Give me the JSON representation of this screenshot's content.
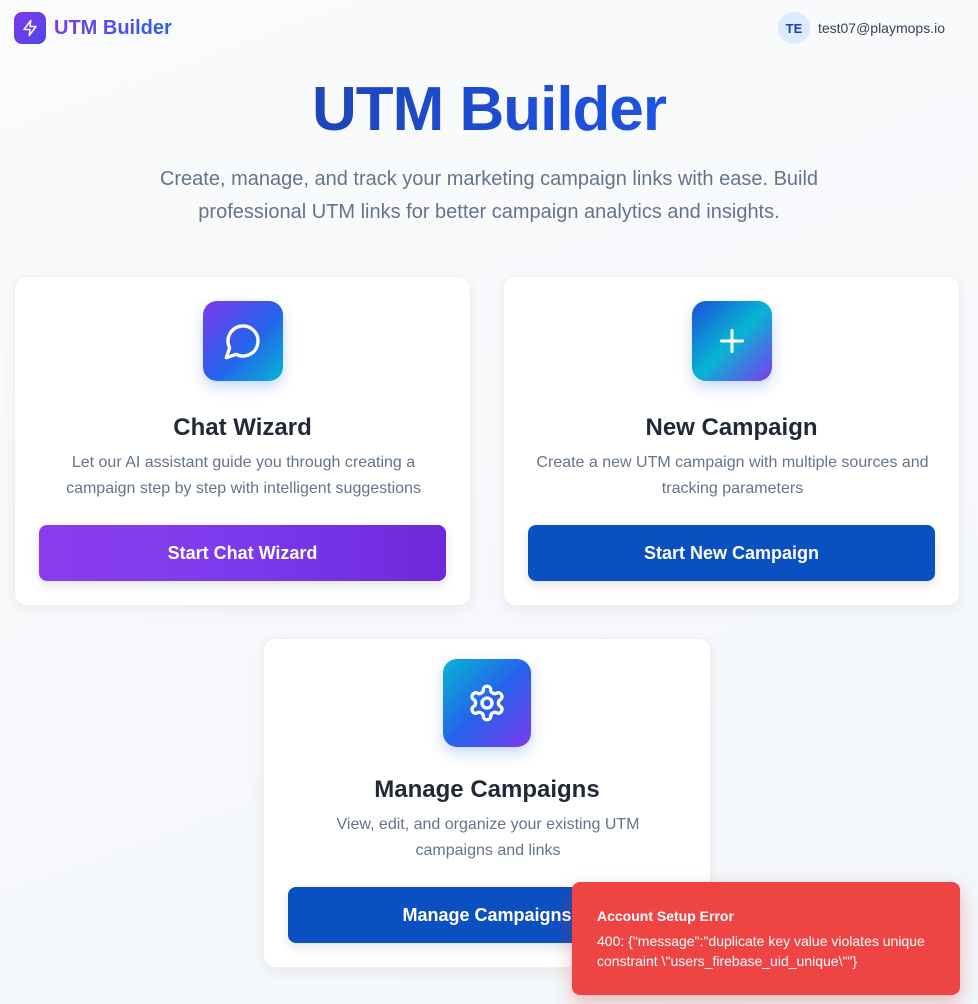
{
  "header": {
    "app_name": "UTM Builder",
    "logo_icon": "lightning-bolt-icon",
    "user": {
      "initials": "TE",
      "email": "test07@playmops.io"
    }
  },
  "hero": {
    "title": "UTM Builder",
    "subtitle": "Create, manage, and track your marketing campaign links with ease. Build professional UTM links for better campaign analytics and insights."
  },
  "cards": {
    "chat_wizard": {
      "icon": "chat-bubble-icon",
      "title": "Chat Wizard",
      "description": "Let our AI assistant guide you through creating a campaign step by step with intelligent suggestions",
      "button_label": "Start Chat Wizard"
    },
    "new_campaign": {
      "icon": "plus-icon",
      "title": "New Campaign",
      "description": "Create a new UTM campaign with multiple sources and tracking parameters",
      "button_label": "Start New Campaign"
    },
    "manage_campaigns": {
      "icon": "gear-icon",
      "title": "Manage Campaigns",
      "description": "View, edit, and organize your existing UTM campaigns and links",
      "button_label": "Manage Campaigns"
    }
  },
  "toast": {
    "title": "Account Setup Error",
    "message": "400: {\"message\":\"duplicate key value violates unique constraint \\\"users_firebase_uid_unique\\\"\"}"
  },
  "colors": {
    "purple_accent": "#7c3aed",
    "blue_accent": "#0b50c1",
    "error": "#ef4444"
  }
}
